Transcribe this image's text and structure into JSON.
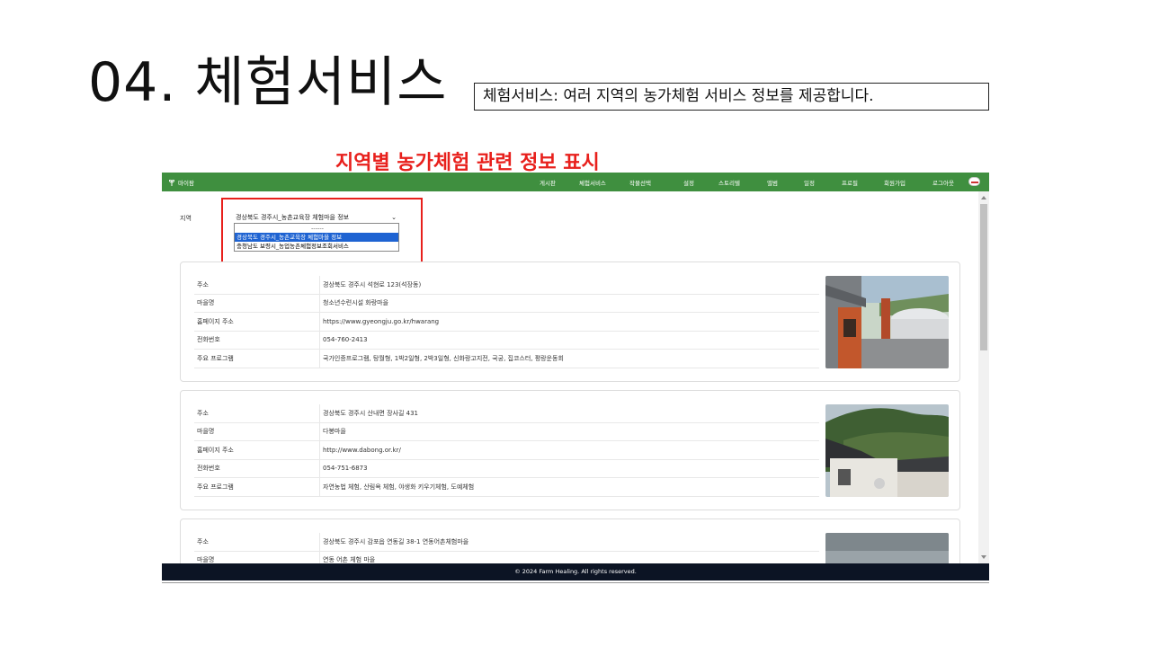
{
  "slide": {
    "title": "04. 체험서비스",
    "description": "체험서비스: 여러 지역의 농가체험 서비스 정보를 제공합니다.",
    "subtitle": "지역별 농가체험 관련 정보 표시"
  },
  "nav": {
    "brand": "마이팜",
    "items": [
      "게시판",
      "체험서비스",
      "작물선택",
      "설정",
      "스토리텔",
      "앨범",
      "일정",
      "프로필",
      "회원가입",
      "로그아웃"
    ]
  },
  "region": {
    "label": "지역",
    "selected": "경상북도 경주시_농촌교육장 체험마을 정보",
    "options": [
      "------",
      "경상북도 경주시_농촌교육장 체험마을 정보",
      "충청남도 보령시_농업농촌체험정보조회서비스"
    ]
  },
  "cards": [
    {
      "rows": [
        {
          "key": "주소",
          "value": "경상북도 경주시 석현로 123(석장동)"
        },
        {
          "key": "마을명",
          "value": "청소년수련시설 화랑마을"
        },
        {
          "key": "홈페이지 주소",
          "value": "https://www.gyeongju.go.kr/hwarang"
        },
        {
          "key": "전화번호",
          "value": "054-760-2413"
        },
        {
          "key": "주요 프로그램",
          "value": "국가인증프로그램, 탕월형, 1박2일형, 2박3일형, 신화랑고지전, 국궁, 집코스터, 평랑운동회"
        }
      ]
    },
    {
      "rows": [
        {
          "key": "주소",
          "value": "경상북도 경주시 산내면 장사길 431"
        },
        {
          "key": "마을명",
          "value": "다봉마을"
        },
        {
          "key": "홈페이지 주소",
          "value": "http://www.dabong.or.kr/"
        },
        {
          "key": "전화번호",
          "value": "054-751-6873"
        },
        {
          "key": "주요 프로그램",
          "value": "자연농법 체험, 산림욕 체험, 야생화 키우기체험, 도예체험"
        }
      ]
    },
    {
      "rows": [
        {
          "key": "주소",
          "value": "경상북도 경주시 감포읍 연동길 38-1 연동어촌체험마을"
        },
        {
          "key": "마을명",
          "value": "연동 어촌 체험 마을"
        }
      ]
    }
  ],
  "footer": {
    "text": "© 2024 Farm Healing. All rights reserved."
  },
  "colors": {
    "nav_bg": "#3f8f3f",
    "highlight": "#e8201c",
    "footer_bg": "#0c1424",
    "option_selected": "#1e63d2"
  }
}
